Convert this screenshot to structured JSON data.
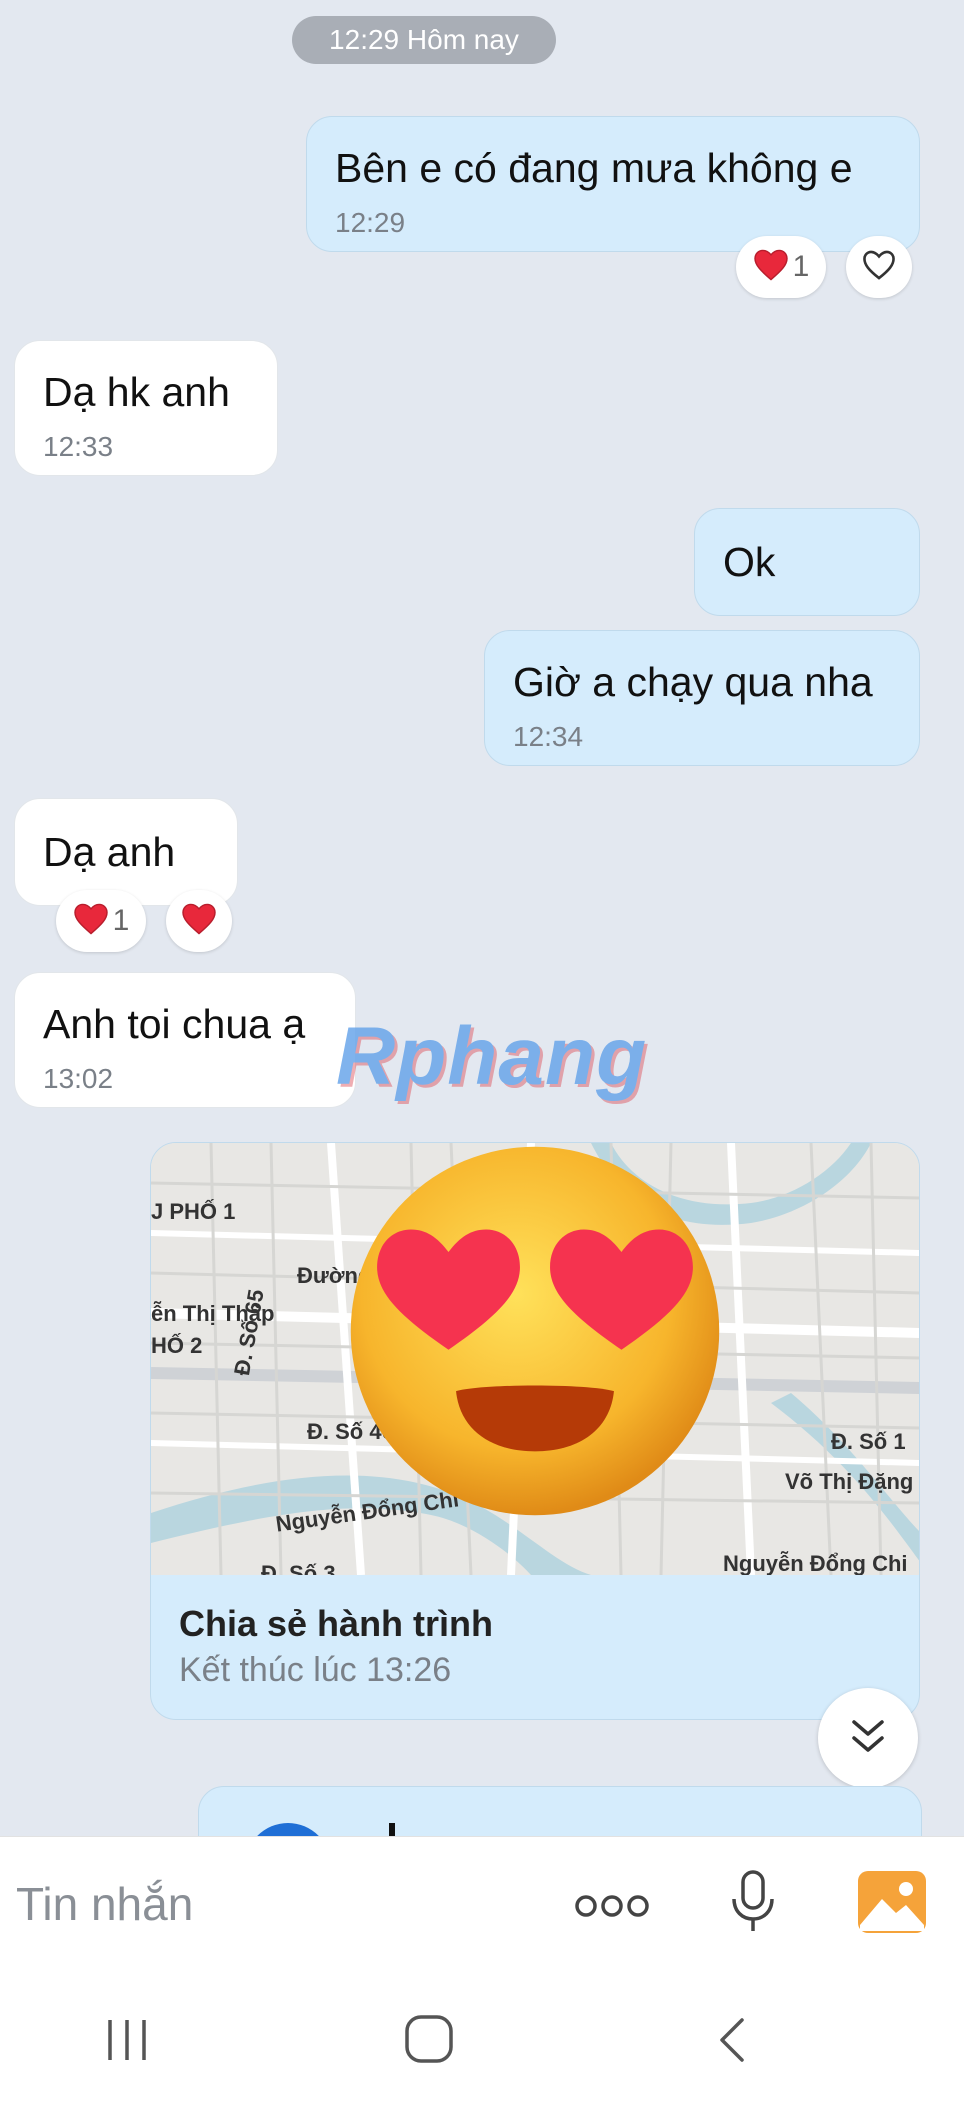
{
  "header": {
    "date_label": "12:29 Hôm nay"
  },
  "messages": [
    {
      "side": "me",
      "text": "Bên e có đang mưa không e",
      "time": "12:29"
    },
    {
      "side": "them",
      "text": "Dạ  hk anh",
      "time": "12:33"
    },
    {
      "side": "me",
      "text": "Ok",
      "time": ""
    },
    {
      "side": "me",
      "text": "Giờ a chạy qua nha",
      "time": "12:34"
    },
    {
      "side": "them",
      "text": "Dạ anh",
      "time": ""
    },
    {
      "side": "them",
      "text": "Anh toi chua ạ",
      "time": "13:02"
    }
  ],
  "reactions": {
    "msg1_count": "1",
    "msg5_count": "1"
  },
  "watermark": "Rphang",
  "map_card": {
    "title": "Chia sẻ hành trình",
    "subtitle": "Kết thúc lúc 13:26",
    "labels": [
      "J PHỐ 1",
      "Đường",
      "ễn Thị Thập",
      "HỐ 2",
      "Đ. Số 65",
      "Đ. Số 40",
      "Nguyễn Đổng Chi",
      "Đ. Số 1",
      "Võ Thị Đặng",
      "Nguyễn Đổng Chi",
      "Đ. Số 3"
    ]
  },
  "input": {
    "placeholder": "Tin nhắn"
  },
  "icons": {
    "heart_reaction": "heart-filled-icon",
    "heart_outline": "heart-outline-icon",
    "more": "more-dots-icon",
    "mic": "microphone-icon",
    "image": "image-icon",
    "scroll": "scroll-down-icon",
    "recent": "recent-apps-icon",
    "home": "home-icon",
    "back": "back-icon"
  },
  "colors": {
    "background": "#e3e8f0",
    "my_bubble": "#d5ecfc",
    "their_bubble": "#ffffff",
    "accent_heart": "#e8283b",
    "image_button": "#f5a33a"
  }
}
